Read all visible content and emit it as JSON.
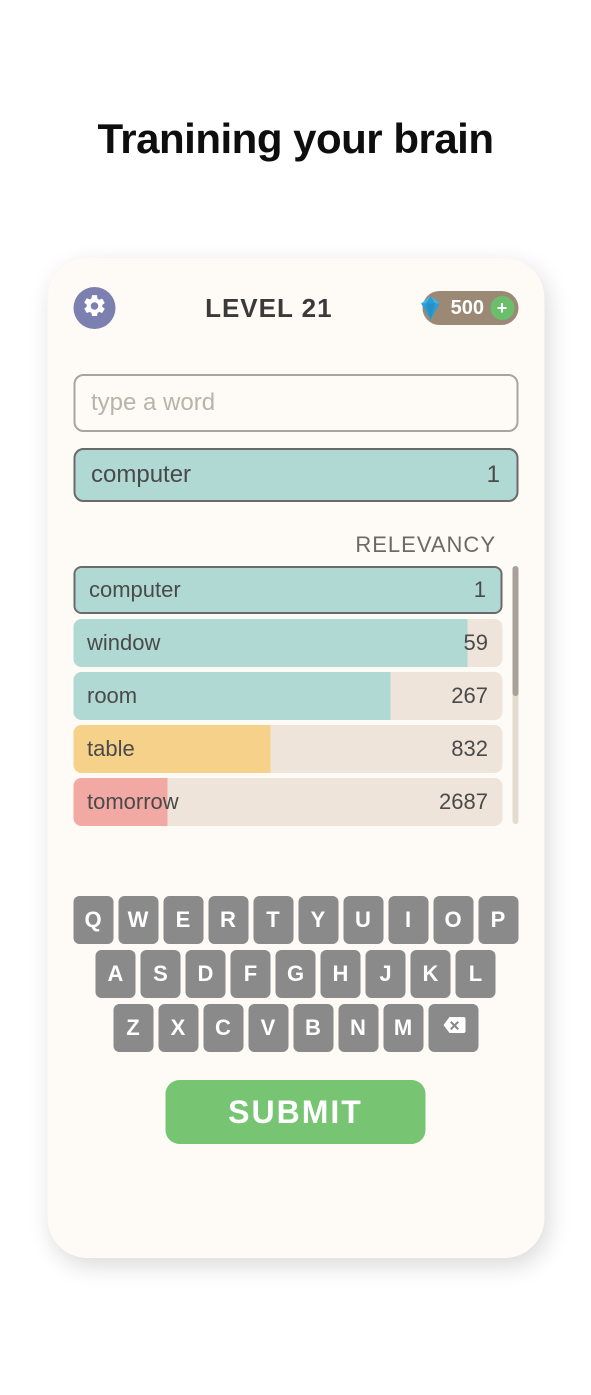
{
  "headline": "Tranining your brain",
  "level_label": "LEVEL 21",
  "gems": "500",
  "input_placeholder": "type a word",
  "top_guess": {
    "word": "computer",
    "score": "1"
  },
  "relevancy_label": "RELEVANCY",
  "rows": [
    {
      "word": "computer",
      "score": "1",
      "fill_pct": 100,
      "color": "#b0d9d4",
      "outlined": true
    },
    {
      "word": "window",
      "score": "59",
      "fill_pct": 92,
      "color": "#b0d9d4",
      "outlined": false
    },
    {
      "word": "room",
      "score": "267",
      "fill_pct": 74,
      "color": "#b0d9d4",
      "outlined": false
    },
    {
      "word": "table",
      "score": "832",
      "fill_pct": 46,
      "color": "#f5d18a",
      "outlined": false
    },
    {
      "word": "tomorrow",
      "score": "2687",
      "fill_pct": 22,
      "color": "#f2a9a4",
      "outlined": false
    }
  ],
  "keyboard": {
    "row1": [
      "Q",
      "W",
      "E",
      "R",
      "T",
      "Y",
      "U",
      "I",
      "O",
      "P"
    ],
    "row2": [
      "A",
      "S",
      "D",
      "F",
      "G",
      "H",
      "J",
      "K",
      "L"
    ],
    "row3": [
      "Z",
      "X",
      "C",
      "V",
      "B",
      "N",
      "M"
    ]
  },
  "submit_label": "SUBMIT"
}
